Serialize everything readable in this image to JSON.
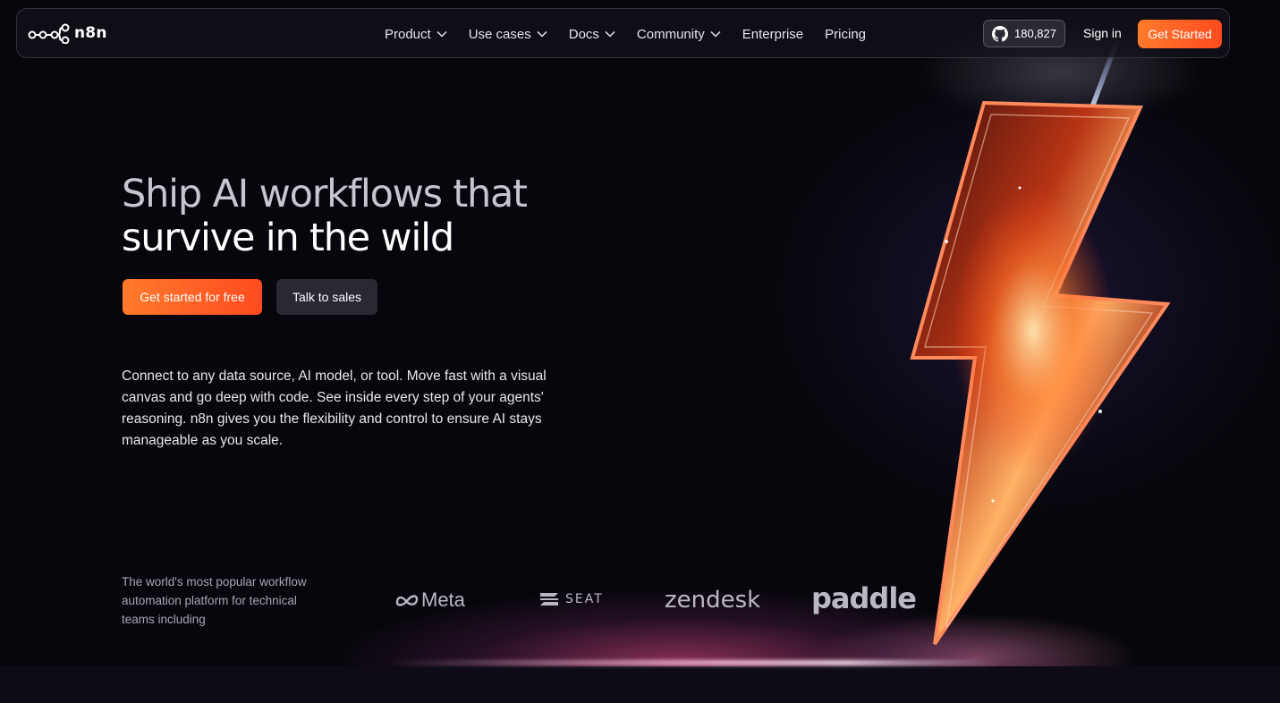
{
  "brand": {
    "name": "n8n",
    "accent_color": "#ff5a1f"
  },
  "nav": {
    "items": [
      {
        "label": "Product",
        "has_dropdown": true
      },
      {
        "label": "Use cases",
        "has_dropdown": true
      },
      {
        "label": "Docs",
        "has_dropdown": true
      },
      {
        "label": "Community",
        "has_dropdown": true
      },
      {
        "label": "Enterprise",
        "has_dropdown": false
      },
      {
        "label": "Pricing",
        "has_dropdown": false
      }
    ],
    "github_stars": "180,827",
    "github_icon": "github-icon",
    "sign_in_label": "Sign in",
    "get_started_label": "Get Started"
  },
  "hero": {
    "headline_line1": "Ship AI workflows that",
    "headline_line2": "survive in the wild",
    "primary_cta": "Get started for free",
    "secondary_cta": "Talk to sales",
    "description": "Connect to any data source, AI model, or tool. Move fast with a visual canvas and go deep with code. See inside every step of your agents' reasoning. n8n gives you the flexibility and control to ensure AI stays manageable as you scale."
  },
  "trusted": {
    "text": "The world's most popular workflow automation platform for technical teams including",
    "logos": [
      "Meta",
      "SEAT",
      "zendesk",
      "paddle"
    ]
  }
}
